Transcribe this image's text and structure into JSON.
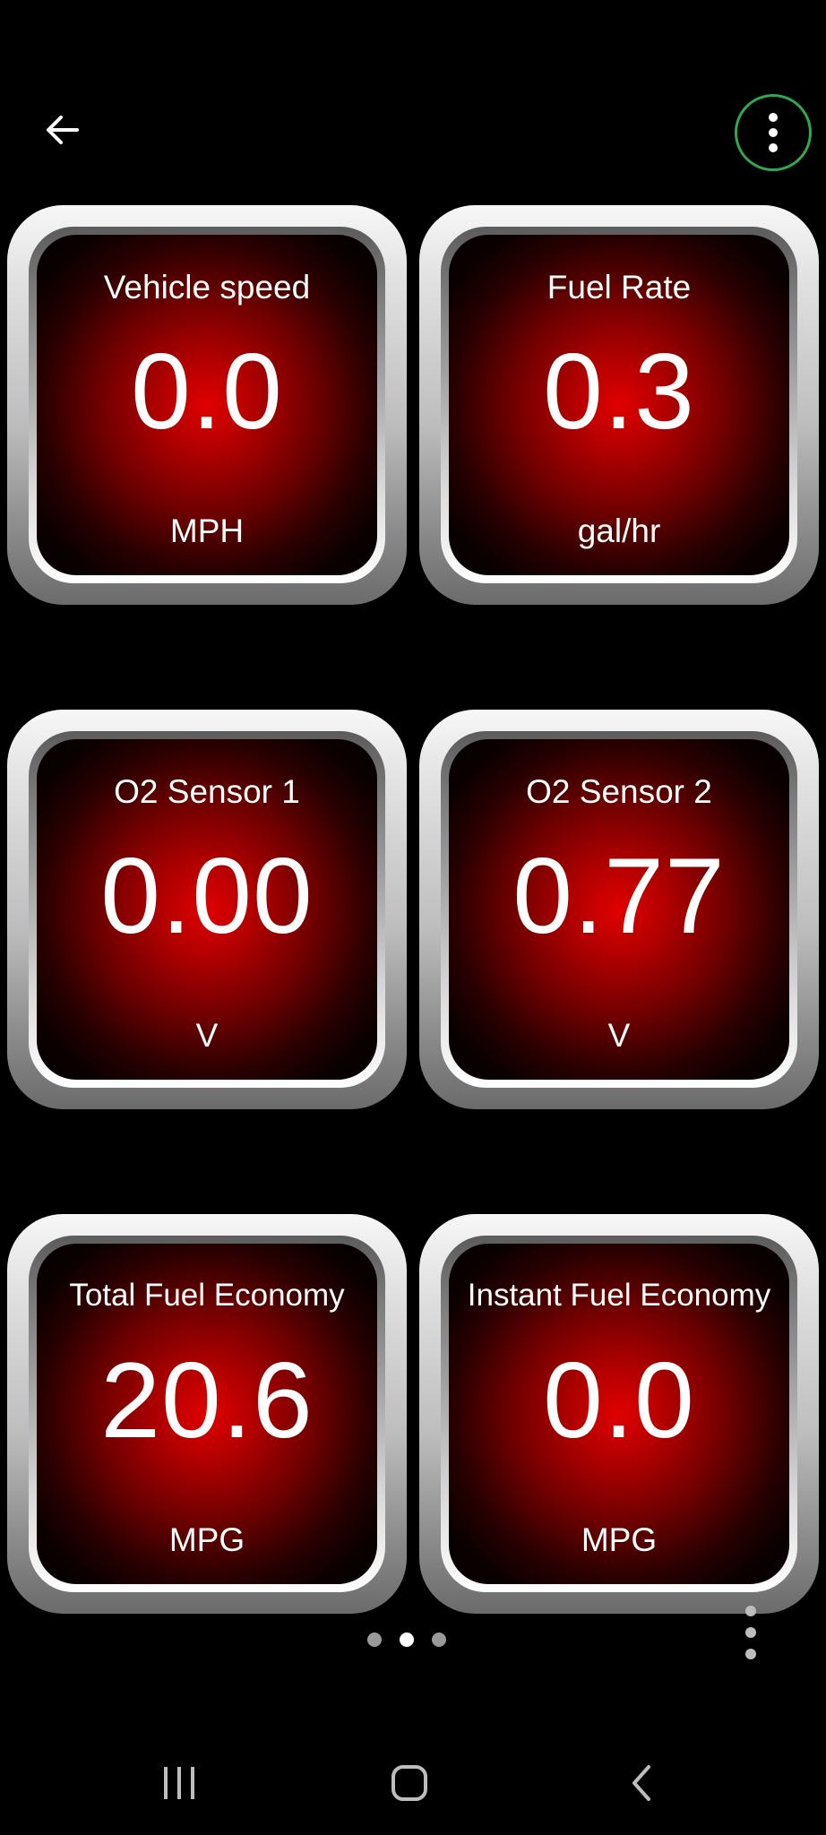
{
  "toolbar": {
    "back_icon": "arrow-left-icon",
    "menu_icon": "more-vertical-icon",
    "menu_ring_color": "#2fa84f"
  },
  "gauges": [
    {
      "title": "Vehicle speed",
      "value": "0.0",
      "unit": "MPH"
    },
    {
      "title": "Fuel Rate",
      "value": "0.3",
      "unit": "gal/hr"
    },
    {
      "title": "O2 Sensor 1",
      "value": "0.00",
      "unit": "V"
    },
    {
      "title": "O2 Sensor 2",
      "value": "0.77",
      "unit": "V"
    },
    {
      "title": "Total Fuel Economy",
      "value": "20.6",
      "unit": "MPG"
    },
    {
      "title": "Instant Fuel Economy",
      "value": "0.0",
      "unit": "MPG"
    }
  ],
  "pager": {
    "page_count": 3,
    "active_page": 2
  },
  "colors": {
    "background": "#000000",
    "gauge_face": "#e00000",
    "text": "#ffffff"
  },
  "system_nav": {
    "recents_icon": "recent-apps-icon",
    "home_icon": "home-icon",
    "back_icon": "back-chevron-icon"
  }
}
